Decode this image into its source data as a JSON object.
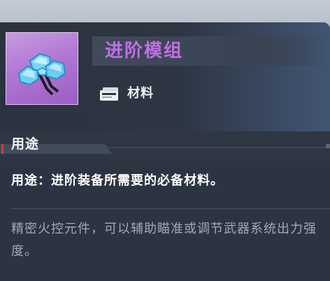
{
  "item": {
    "name": "进阶模组",
    "name_color": "#c06ee6",
    "rarity_color": "#b177d4",
    "icon": "module-crystal-icon",
    "type_icon": "material-icon",
    "type_label": "材料"
  },
  "section": {
    "title": "用途",
    "accent_color": "#c8413b"
  },
  "usage_text": "用途：进阶装备所需要的必备材料。",
  "description": "精密火控元件，可以辅助瞄准或调节武器系统出力强度。"
}
